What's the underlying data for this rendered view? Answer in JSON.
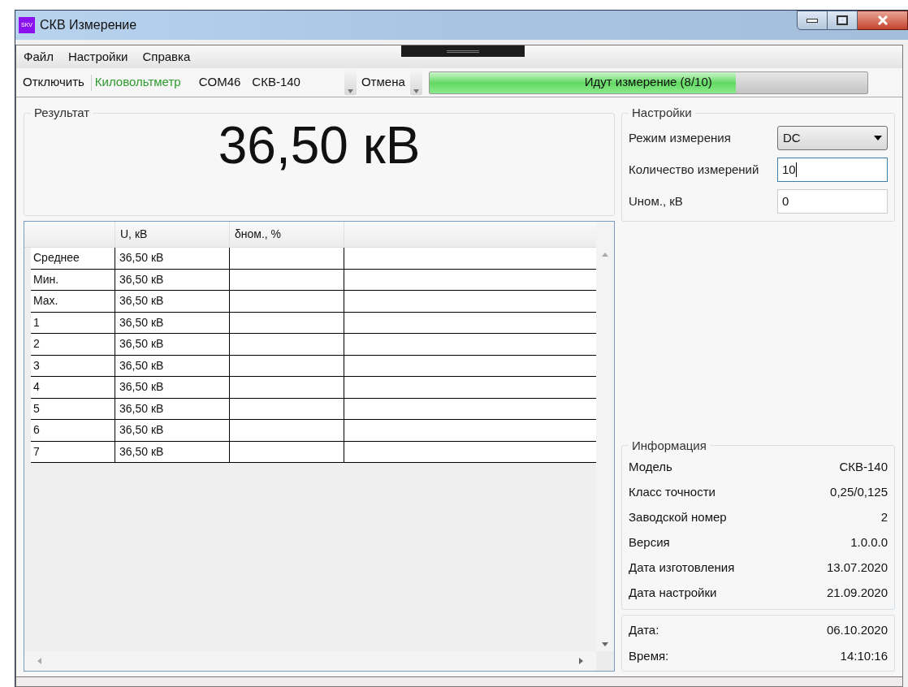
{
  "window": {
    "title": "СКВ Измерение",
    "logo_text": "SKV"
  },
  "menu": [
    "Файл",
    "Настройки",
    "Справка"
  ],
  "toolbar": {
    "disconnect_button": "Отключить",
    "device_type": "Киловольтметр",
    "port": "COM46",
    "model": "СКВ-140",
    "cancel_button": "Отмена",
    "progress": {
      "text": "Идут измерение (8/10)",
      "level": 0.7
    }
  },
  "result": {
    "title": "Результат",
    "value": "36,50 кВ"
  },
  "table": {
    "columns": [
      "U, кВ",
      "δном., %"
    ],
    "rows": [
      {
        "label": "Среднее",
        "u": "36,50 кВ"
      },
      {
        "label": "Мин.",
        "u": "36,50 кВ"
      },
      {
        "label": "Max.",
        "u": "36,50 кВ"
      },
      {
        "label": "1",
        "u": "36,50 кВ"
      },
      {
        "label": "2",
        "u": "36,50 кВ"
      },
      {
        "label": "3",
        "u": "36,50 кВ"
      },
      {
        "label": "4",
        "u": "36,50 кВ"
      },
      {
        "label": "5",
        "u": "36,50 кВ"
      },
      {
        "label": "6",
        "u": "36,50 кВ"
      },
      {
        "label": "7",
        "u": "36,50 кВ"
      }
    ]
  },
  "settings": {
    "title": "Настройки",
    "fields": [
      {
        "kind": "select",
        "label": "Режим измерения",
        "value": "DC",
        "focused": false
      },
      {
        "kind": "input",
        "label": "Количество измерений",
        "value": "10",
        "focused": true
      },
      {
        "kind": "input",
        "label": "Uном., кВ",
        "value": "0",
        "focused": false
      }
    ]
  },
  "info": {
    "title": "Информация",
    "rows": [
      {
        "label": "Модель",
        "value": "СКВ-140"
      },
      {
        "label": "Класс точности",
        "value": "0,25/0,125"
      },
      {
        "label": "Заводской номер",
        "value": "2"
      },
      {
        "label": "Версия",
        "value": "1.0.0.0"
      },
      {
        "label": "Дата изготовления",
        "value": "13.07.2020"
      },
      {
        "label": "Дата настройки",
        "value": "21.09.2020"
      }
    ]
  },
  "clock": {
    "rows": [
      {
        "label": "Дата:",
        "value": "06.10.2020"
      },
      {
        "label": "Время:",
        "value": "14:10:16"
      }
    ]
  }
}
